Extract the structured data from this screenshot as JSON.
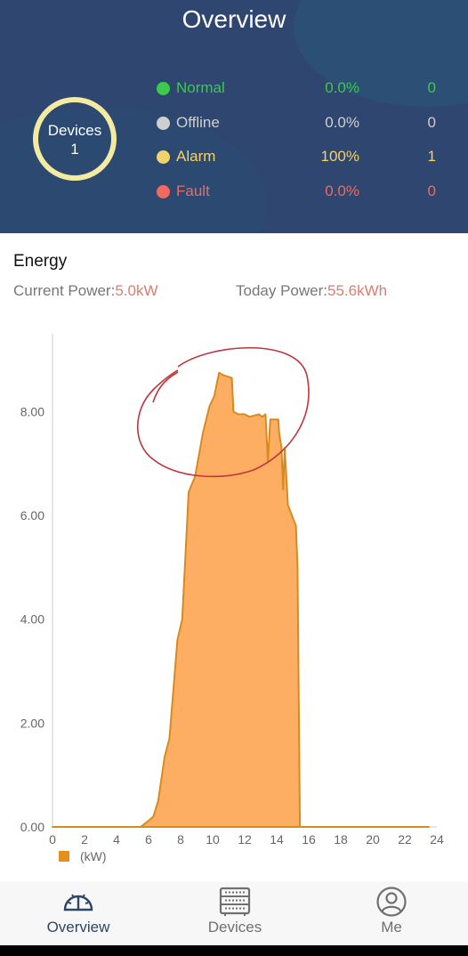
{
  "header": {
    "title": "Overview"
  },
  "devices_ring": {
    "label": "Devices",
    "count": "1"
  },
  "status": [
    {
      "label": "Normal",
      "percent": "0.0%",
      "count": "0",
      "color": "#3cc94e"
    },
    {
      "label": "Offline",
      "percent": "0.0%",
      "count": "0",
      "color": "#cfcfcf"
    },
    {
      "label": "Alarm",
      "percent": "100%",
      "count": "1",
      "color": "#f2d36a"
    },
    {
      "label": "Fault",
      "percent": "0.0%",
      "count": "0",
      "color": "#f06a62"
    }
  ],
  "energy": {
    "title": "Energy",
    "current_label": "Current Power:",
    "current_value": "5.0kW",
    "today_label": "Today Power:",
    "today_value": "55.6kWh"
  },
  "chart_data": {
    "type": "area",
    "x_ticks": [
      "0",
      "2",
      "4",
      "6",
      "8",
      "10",
      "12",
      "14",
      "16",
      "18",
      "20",
      "22",
      "24"
    ],
    "y_ticks": [
      "0.00",
      "2.00",
      "4.00",
      "6.00",
      "8.00"
    ],
    "xlim": [
      0,
      24
    ],
    "ylim": [
      0,
      9.5
    ],
    "legend": [
      {
        "name": "(kW)",
        "color": "#e58e1a"
      }
    ],
    "fill_color": "#fdae62",
    "line_color": "#d98a1e",
    "annotation_color": "#c0353a",
    "x": [
      0,
      5.5,
      6.0,
      6.3,
      6.6,
      7.0,
      7.3,
      7.8,
      8.1,
      8.5,
      8.9,
      9.4,
      9.8,
      10.1,
      10.4,
      10.7,
      11.2,
      11.3,
      11.6,
      12.0,
      12.3,
      12.9,
      13.1,
      13.3,
      13.45,
      13.6,
      14.1,
      14.15,
      14.3,
      14.4,
      14.5,
      14.7,
      15.2,
      15.3,
      15.45,
      15.5,
      23.5
    ],
    "y": [
      0,
      0,
      0.12,
      0.2,
      0.5,
      1.35,
      1.7,
      3.6,
      4.0,
      6.45,
      6.75,
      7.6,
      8.1,
      8.3,
      8.75,
      8.7,
      8.65,
      8.0,
      7.95,
      7.95,
      7.9,
      7.95,
      7.9,
      7.95,
      7.05,
      7.85,
      7.85,
      7.6,
      7.3,
      6.5,
      7.3,
      6.2,
      5.8,
      5.0,
      0,
      0,
      0
    ]
  },
  "tabbar": {
    "items": [
      {
        "label": "Overview",
        "active": true
      },
      {
        "label": "Devices",
        "active": false
      },
      {
        "label": "Me",
        "active": false
      }
    ]
  }
}
